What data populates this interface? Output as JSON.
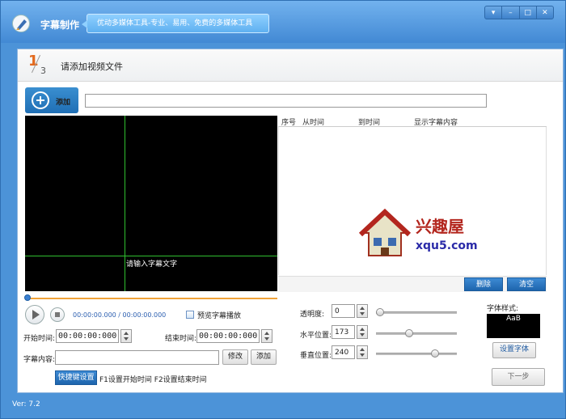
{
  "app": {
    "title": "字幕制作",
    "tagline": "优动多媒体工具-专业、易用、免费的多媒体工具",
    "version": "Ver: 7.2"
  },
  "window_controls": {
    "menu": "▾",
    "minimize": "–",
    "maximize": "□",
    "close": "✕"
  },
  "step": {
    "current": "1",
    "total": "3",
    "title": "请添加视频文件"
  },
  "toolbar": {
    "add_label": "添加",
    "path_value": ""
  },
  "video": {
    "hint": "请输入字幕文字"
  },
  "subtitle_list": {
    "columns": [
      "序号",
      "从时间",
      "到时间",
      "显示字幕内容"
    ],
    "rows": [],
    "delete_label": "删除",
    "clear_label": "清空"
  },
  "watermark": {
    "brand": "兴趣屋",
    "url": "xqu5.com"
  },
  "playback": {
    "time": "00:00:00.000 / 00:00:00.000",
    "preview_label": "预览字幕播放",
    "preview_checked": false,
    "progress": 0
  },
  "timing": {
    "start_label": "开始时间:",
    "start_value": "00:00:00:000",
    "end_label": "结束时间:",
    "end_value": "00:00:00:000"
  },
  "content": {
    "label": "字幕内容:",
    "value": "",
    "modify_label": "修改",
    "add_label": "添加"
  },
  "shortcuts": {
    "button_label": "快捷键设置",
    "hint": "F1设置开始时间 F2设置结束时间"
  },
  "style": {
    "opacity_label": "透明度:",
    "opacity_value": "0",
    "hpos_label": "水平位置:",
    "hpos_value": "173",
    "vpos_label": "垂直位置:",
    "vpos_value": "240",
    "font_style_label": "字体样式:",
    "font_preview": "AaB",
    "set_font_label": "设置字体",
    "opacity_slider": 0.0,
    "hpos_slider": 0.4,
    "vpos_slider": 0.76
  },
  "next_label": "下一步",
  "colors": {
    "accent": "#1f6fb5",
    "window": "#4c93d8",
    "step_number": "#e36a1e",
    "guide_line": "#2fbf2f"
  }
}
